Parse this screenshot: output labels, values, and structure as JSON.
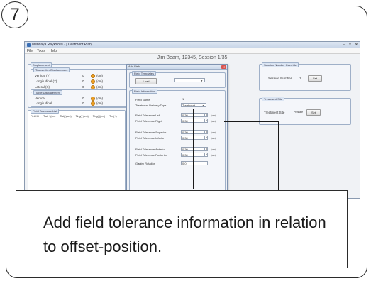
{
  "step_number": "7",
  "window": {
    "title": "Mensaya RayPilot® - [Treatment Plan]",
    "controls": [
      "–",
      "□",
      "✕"
    ],
    "menu": [
      "File",
      "Tools",
      "Help"
    ],
    "session_header": "Jim Beam, 12345, Session 1/35"
  },
  "displacement": {
    "title": "Displacement",
    "transmitter_title": "Transmitter Displacement",
    "transmitter_rows": [
      {
        "label": "Vertical (Y)",
        "value": "0",
        "unit": "(cm)"
      },
      {
        "label": "Longitudinal (Z)",
        "value": "0",
        "unit": "(cm)"
      },
      {
        "label": "Lateral (X)",
        "value": "0",
        "unit": "(cm)"
      }
    ],
    "table_title": "Table Displacement",
    "table_rows": [
      {
        "label": "Vertical",
        "value": "0",
        "unit": "(cm)"
      },
      {
        "label": "Longitudinal",
        "value": "0",
        "unit": "(cm)"
      }
    ]
  },
  "tolerance_list": {
    "title": "Field Tolerance List",
    "columns": [
      "Field ID",
      "Tlat(+)(cm)",
      "Tlat(-)(cm)",
      "Tlng(+)(cm)",
      "Tlng(-)(cm)",
      "Tvrt(+)"
    ]
  },
  "session_overview": {
    "title": "Session Number Override",
    "label": "Session Number",
    "value": "1",
    "button": "Set"
  },
  "treatment_site": {
    "title": "Treatment Site",
    "label": "Treatment Site",
    "value": "Prostate",
    "button": "Set"
  },
  "dialog": {
    "title": "Add Field",
    "close": "✕",
    "templates_title": "Field Templates",
    "load_button": "Load",
    "template_select": "",
    "info_title": "Field Information",
    "field_name_label": "Field Name",
    "field_name_value": "f1",
    "delivery_type_label": "Treatment Delivery Type",
    "delivery_type_value": "Treatment",
    "tolerances": [
      {
        "label": "Field Tolerance Left",
        "value": "0.30",
        "unit": "(cm)"
      },
      {
        "label": "Field Tolerance Right",
        "value": "0.30",
        "unit": "(cm)"
      },
      {
        "label": "Field Tolerance Superior",
        "value": "0.30",
        "unit": "(cm)"
      },
      {
        "label": "Field Tolerance Inferior",
        "value": "0.30",
        "unit": "(cm)"
      },
      {
        "label": "Field Tolerance Anterior",
        "value": "0.30",
        "unit": "(cm)"
      },
      {
        "label": "Field Tolerance Posterior",
        "value": "0.30",
        "unit": "(cm)"
      },
      {
        "label": "Gantry Rotation",
        "value": "0.0",
        "unit": ""
      }
    ]
  },
  "callout": {
    "text": "Add field tolerance information in relation to offset-position."
  },
  "colors": {
    "status_dot": "#f0a020",
    "close_button": "#d9534f",
    "frame": "#2b2b2b"
  }
}
